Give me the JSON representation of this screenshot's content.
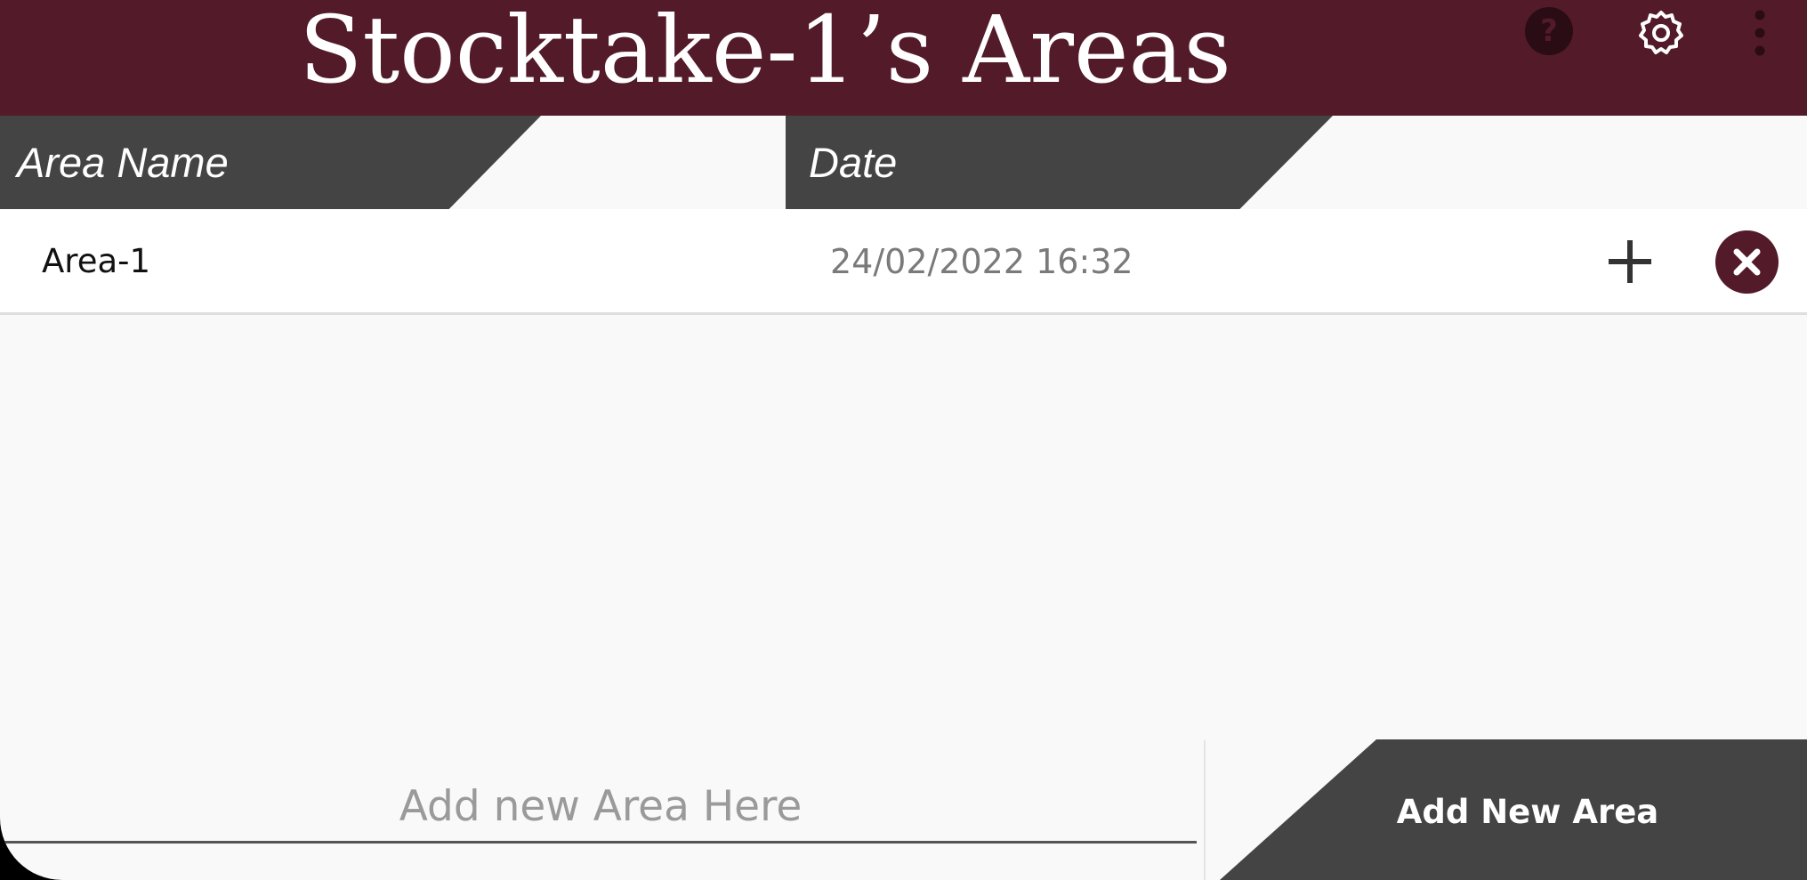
{
  "header": {
    "title": "Stocktake-1’s Areas",
    "background": "#531a29",
    "icons": [
      "help-icon",
      "gear-icon",
      "more-vertical-icon"
    ]
  },
  "columns": {
    "name": "Area Name",
    "date": "Date"
  },
  "rows": [
    {
      "name": "Area-1",
      "date": "24/02/2022 16:32",
      "actions": [
        "plus-icon",
        "delete-icon"
      ]
    }
  ],
  "new_area": {
    "placeholder": "Add new Area Here",
    "value": "",
    "button_label": "Add New Area"
  },
  "colors": {
    "accent": "#531a29",
    "header_strip": "#444444",
    "delete_button": "#531a29"
  }
}
